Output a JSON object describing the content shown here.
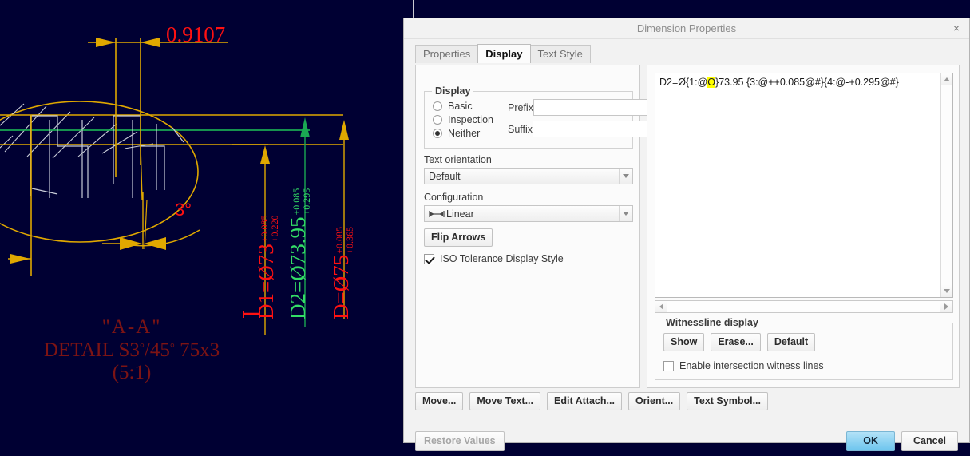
{
  "cad": {
    "dimension_09107": "0.9107",
    "angle_label": "3°",
    "detail": {
      "line1": "\"A-A\"",
      "line2_prefix": "DETAIL S3",
      "line2_deg1": "°",
      "line2_mid": "/45",
      "line2_deg2": "°",
      "line2_suffix": " 75x3",
      "line3": "(5:1)"
    },
    "dims": [
      {
        "name": "D1",
        "text": "D1=Ø73",
        "upper": "+0.085",
        "lower": "+0.220",
        "color": "#ff1111"
      },
      {
        "name": "D2",
        "text": "D2=Ø73.95",
        "upper": "+0.085",
        "lower": "+0.295",
        "color": "#33dd66"
      },
      {
        "name": "D",
        "text": "D=Ø75",
        "upper": "+0.085",
        "lower": "+0.365",
        "color": "#ff1111"
      }
    ],
    "colors": {
      "background": "#000033",
      "geometry_gold": "#e0a800",
      "geometry_white": "#c8ccd8",
      "highlight_green": "#1aa853",
      "text_red": "#ff1111",
      "detail_red": "#7d1414"
    }
  },
  "dialog": {
    "title": "Dimension Properties",
    "close_label": "×",
    "tabs": [
      {
        "label": "Properties",
        "active": false
      },
      {
        "label": "Display",
        "active": true
      },
      {
        "label": "Text Style",
        "active": false
      }
    ],
    "display_group": {
      "legend": "Display",
      "radios": [
        {
          "label": "Basic",
          "checked": false
        },
        {
          "label": "Inspection",
          "checked": false
        },
        {
          "label": "Neither",
          "checked": true
        }
      ],
      "prefix_label": "Prefix",
      "prefix_value": "",
      "prefix_placeholder": "",
      "suffix_label": "Suffix",
      "suffix_value": "",
      "suffix_placeholder": ""
    },
    "text_orientation_label": "Text orientation",
    "text_orientation_value": "Default",
    "configuration_label": "Configuration",
    "configuration_value": "Linear",
    "configuration_icon": "linear-dimension-icon",
    "flip_arrows_label": "Flip Arrows",
    "iso_tolerance": {
      "label": "ISO Tolerance Display Style",
      "checked": true
    },
    "editor": {
      "text_before": "D2=Ø{1:@",
      "text_highlight": "O",
      "text_after": "}73.95 {3:@++0.085@#}{4:@-+0.295@#}",
      "full_text": "D2=Ø{1:@O}73.95 {3:@++0.085@#}{4:@-+0.295@#}",
      "highlight_color": "#ffff00"
    },
    "witnessline": {
      "legend": "Witnessline display",
      "buttons": [
        "Show",
        "Erase...",
        "Default"
      ],
      "checkbox_label": "Enable intersection witness lines",
      "checkbox_checked": false
    },
    "action_buttons": [
      "Move...",
      "Move Text...",
      "Edit Attach...",
      "Orient...",
      "Text Symbol..."
    ],
    "footer": {
      "restore_label": "Restore Values",
      "restore_disabled": true,
      "ok_label": "OK",
      "cancel_label": "Cancel"
    }
  }
}
